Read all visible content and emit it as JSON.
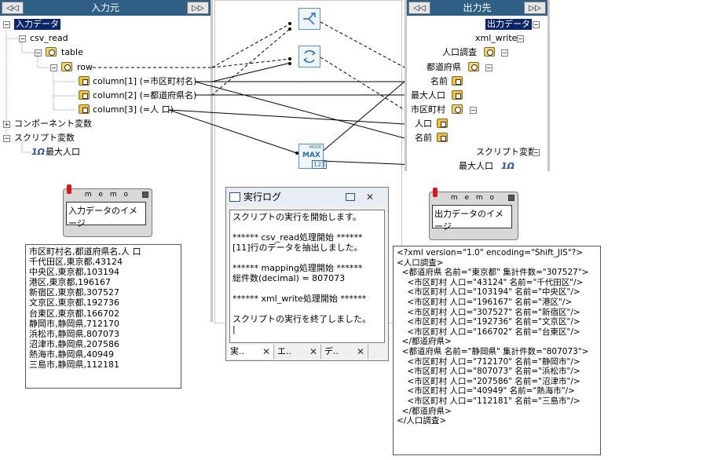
{
  "left_panel": {
    "title": "入力元",
    "btn_prev": "◁◁",
    "btn_next": "▷▷",
    "tree": {
      "root": "入力データ",
      "csv": "csv_read",
      "table": "table",
      "row": "row",
      "columns": [
        "column[1] (=市区町村名)",
        "column[2] (=都道府県名)",
        "column[3] (=人 口)"
      ],
      "component_vars": "コンポーネント変数",
      "script_vars": "スクリプト変数",
      "max_pop": "最大人口"
    }
  },
  "right_panel": {
    "title": "出力先",
    "btn_prev": "◁◁",
    "btn_next": "▷▷",
    "tree": {
      "root": "出力データ",
      "xml": "xml_write",
      "survey": "人口調査",
      "pref": "都道府県",
      "name1": "名前",
      "maxpop": "最大人口",
      "city": "市区町村",
      "pop": "人口",
      "name2": "名前",
      "script_vars": "スクリプト変数",
      "max_pop": "最大人口"
    }
  },
  "center": {
    "func_max_label": "MAX",
    "func_max_top": "MODE",
    "func_max_num": "123"
  },
  "memo_left": {
    "title": "m e m o",
    "text": "入力データのイメージ"
  },
  "memo_right": {
    "title": "m e m o",
    "text": "出力データのイメージ"
  },
  "input_sample": "市区町村名,都道府県名,人 口\n千代田区,東京都,43124\n中央区,東京都,103194\n港区,東京都,196167\n新宿区,東京都,307527\n文京区,東京都,192736\n台東区,東京都,166702\n静岡市,静岡県,712170\n浜松市,静岡県,807073\n沼津市,静岡県,207586\n熱海市,静岡県,40949\n三島市,静岡県,112181",
  "log_window": {
    "title": "実行ログ",
    "body": "スクリプトの実行を開始します。\n\n****** csv_read処理開始 ******\n[11]行のデータを抽出しました。\n\n****** mapping処理開始 ******\n総件数(decimal) = 807073\n\n****** xml_write処理開始 ******\n\nスクリプトの実行を終了しました。\n|",
    "tabs": [
      "実..",
      "エ..",
      "デ.."
    ]
  },
  "output_sample": "<?xml version=\"1.0\" encoding=\"Shift_JIS\"?>\n<人口調査>\n  <都道府県 名前=\"東京都\" 集計件数=\"307527\">\n    <市区町村 人口=\"43124\" 名前=\"千代田区\"/>\n    <市区町村 人口=\"103194\" 名前=\"中央区\"/>\n    <市区町村 人口=\"196167\" 名前=\"港区\"/>\n    <市区町村 人口=\"307527\" 名前=\"新宿区\"/>\n    <市区町村 人口=\"192736\" 名前=\"文京区\"/>\n    <市区町村 人口=\"166702\" 名前=\"台東区\"/>\n  </都道府県>\n  <都道府県 名前=\"静岡県\" 集計件数=\"807073\">\n    <市区町村 人口=\"712170\" 名前=\"静岡市\"/>\n    <市区町村 人口=\"807073\" 名前=\"浜松市\"/>\n    <市区町村 人口=\"207586\" 名前=\"沼津市\"/>\n    <市区町村 人口=\"40949\" 名前=\"熱海市\"/>\n    <市区町村 人口=\"112181\" 名前=\"三島市\"/>\n  </都道府県>\n</人口調査>",
  "colors": {
    "header": "#2f5f85",
    "selection": "#0a246a"
  }
}
